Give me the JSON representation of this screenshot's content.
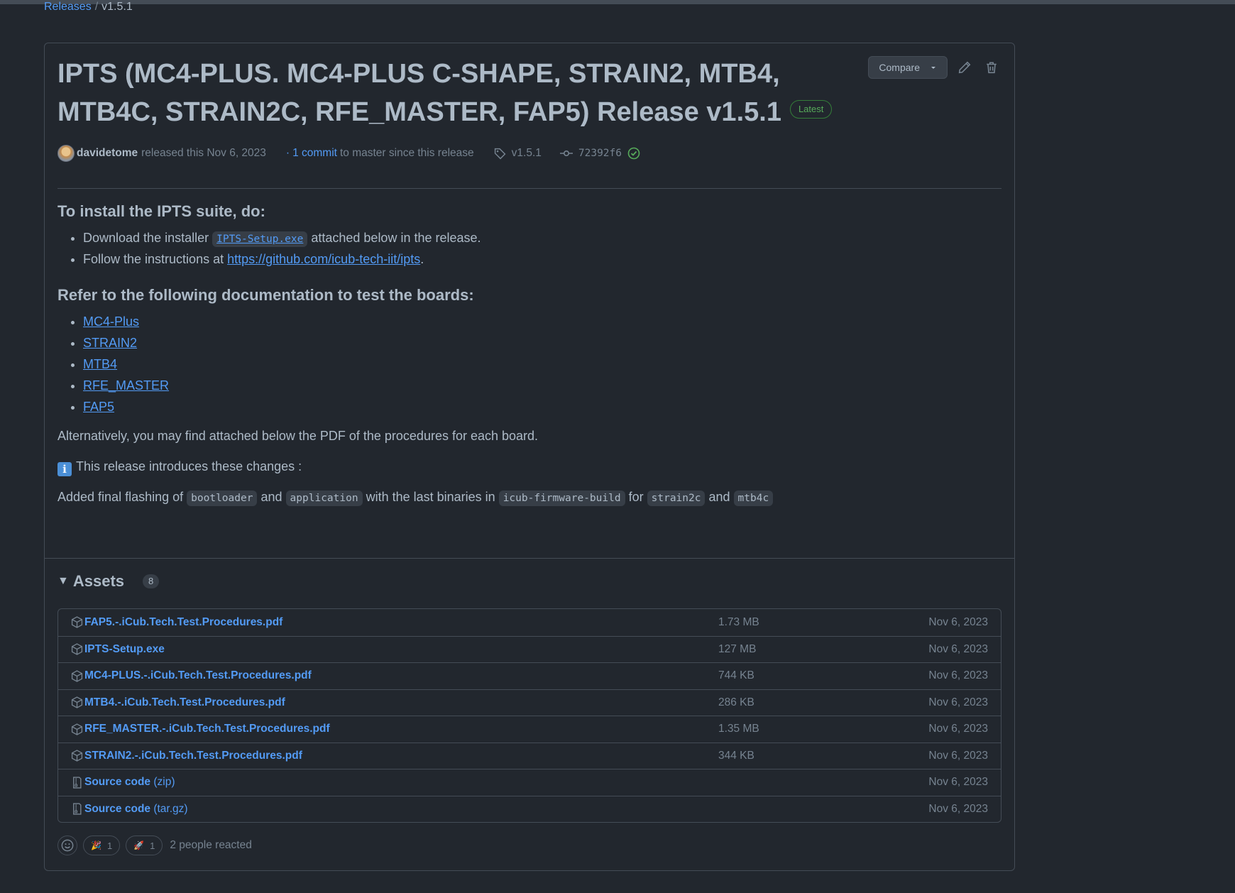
{
  "breadcrumb": {
    "parent": "Releases",
    "separator": "/",
    "current": "v1.5.1"
  },
  "release": {
    "title": "IPTS (MC4-PLUS. MC4-PLUS C-SHAPE, STRAIN2, MTB4, MTB4C, STRAIN2C, RFE_MASTER, FAP5) Release v1.5.1",
    "badge": "Latest",
    "compare_label": "Compare",
    "author": "davidetome",
    "released_text": "released this Nov 6, 2023",
    "commits_prefix": "·",
    "commits_link": "1 commit",
    "commits_suffix": "to master since this release",
    "tag": "v1.5.1",
    "commit_sha": "72392f6"
  },
  "notes": {
    "install_heading": "To install the IPTS suite, do:",
    "install_item1_before": "Download the installer",
    "install_item1_code": "IPTS-Setup.exe",
    "install_item1_after": "attached below in the release.",
    "install_item2_before": "Follow the instructions at",
    "install_item2_link": "https://github.com/icub-tech-iit/ipts",
    "install_item2_after": ".",
    "docs_heading": "Refer to the following documentation to test the boards:",
    "docs_links": [
      "MC4-Plus",
      "STRAIN2",
      "MTB4",
      "RFE_MASTER",
      "FAP5"
    ],
    "alt_text": "Alternatively, you may find attached below the PDF of the procedures for each board.",
    "changes_text": "This release introduces these changes :",
    "changes_line": {
      "t1": "Added final flashing of",
      "c1": "bootloader",
      "t2": "and",
      "c2": "application",
      "t3": "with the last binaries in",
      "c3": "icub-firmware-build",
      "t4": "for",
      "c4": "strain2c",
      "t5": "and",
      "c5": "mtb4c"
    }
  },
  "assets": {
    "heading": "Assets",
    "count": "8",
    "items": [
      {
        "name": "FAP5.-.iCub.Tech.Test.Procedures.pdf",
        "ext": "",
        "size": "1.73 MB",
        "date": "Nov 6, 2023"
      },
      {
        "name": "IPTS-Setup.exe",
        "ext": "",
        "size": "127 MB",
        "date": "Nov 6, 2023"
      },
      {
        "name": "MC4-PLUS.-.iCub.Tech.Test.Procedures.pdf",
        "ext": "",
        "size": "744 KB",
        "date": "Nov 6, 2023"
      },
      {
        "name": "MTB4.-.iCub.Tech.Test.Procedures.pdf",
        "ext": "",
        "size": "286 KB",
        "date": "Nov 6, 2023"
      },
      {
        "name": "RFE_MASTER.-.iCub.Tech.Test.Procedures.pdf",
        "ext": "",
        "size": "1.35 MB",
        "date": "Nov 6, 2023"
      },
      {
        "name": "STRAIN2.-.iCub.Tech.Test.Procedures.pdf",
        "ext": "",
        "size": "344 KB",
        "date": "Nov 6, 2023"
      },
      {
        "name": "Source code",
        "ext": "(zip)",
        "size": "",
        "date": "Nov 6, 2023"
      },
      {
        "name": "Source code",
        "ext": "(tar.gz)",
        "size": "",
        "date": "Nov 6, 2023"
      }
    ]
  },
  "reactions": {
    "tada_emoji": "🎉",
    "tada_count": "1",
    "rocket_emoji": "🚀",
    "rocket_count": "1",
    "summary": "2 people reacted"
  },
  "colors": {
    "background": "#22272e",
    "accent": "#539bf5",
    "success": "#57ab5a",
    "border": "#444c56"
  }
}
